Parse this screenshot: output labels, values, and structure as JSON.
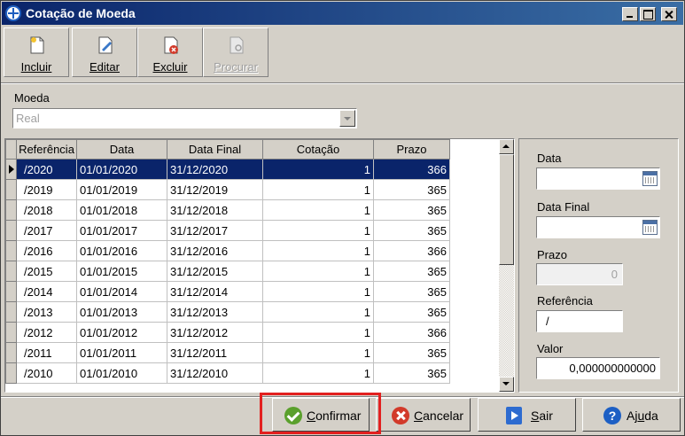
{
  "window": {
    "title": "Cotação de Moeda"
  },
  "toolbar": {
    "items": [
      {
        "label": "Incluir",
        "icon": "new-document-icon",
        "enabled": true
      },
      {
        "label": "Editar",
        "icon": "edit-document-icon",
        "enabled": true
      },
      {
        "label": "Excluir",
        "icon": "delete-document-icon",
        "enabled": true
      },
      {
        "label": "Procurar",
        "icon": "search-document-icon",
        "enabled": false
      }
    ]
  },
  "moeda": {
    "label": "Moeda",
    "value": "Real"
  },
  "grid": {
    "columns": [
      "Referência",
      "Data",
      "Data Final",
      "Cotação",
      "Prazo"
    ],
    "rows": [
      [
        "/2020",
        "01/01/2020",
        "31/12/2020",
        "1",
        "366"
      ],
      [
        "/2019",
        "01/01/2019",
        "31/12/2019",
        "1",
        "365"
      ],
      [
        "/2018",
        "01/01/2018",
        "31/12/2018",
        "1",
        "365"
      ],
      [
        "/2017",
        "01/01/2017",
        "31/12/2017",
        "1",
        "365"
      ],
      [
        "/2016",
        "01/01/2016",
        "31/12/2016",
        "1",
        "366"
      ],
      [
        "/2015",
        "01/01/2015",
        "31/12/2015",
        "1",
        "365"
      ],
      [
        "/2014",
        "01/01/2014",
        "31/12/2014",
        "1",
        "365"
      ],
      [
        "/2013",
        "01/01/2013",
        "31/12/2013",
        "1",
        "365"
      ],
      [
        "/2012",
        "01/01/2012",
        "31/12/2012",
        "1",
        "366"
      ],
      [
        "/2011",
        "01/01/2011",
        "31/12/2011",
        "1",
        "365"
      ],
      [
        "/2010",
        "01/01/2010",
        "31/12/2010",
        "1",
        "365"
      ]
    ],
    "selected_row": 0
  },
  "form": {
    "data_label": "Data",
    "data_value": "",
    "data_final_label": "Data Final",
    "data_final_value": "",
    "prazo_label": "Prazo",
    "prazo_value": "0",
    "referencia_label": "Referência",
    "referencia_value": "/",
    "valor_label": "Valor",
    "valor_value": "0,000000000000"
  },
  "buttons": {
    "confirm": "onfirmar",
    "confirm_key": "C",
    "cancel": "ancelar",
    "cancel_key": "C",
    "exit": "air",
    "exit_key": "S",
    "help": "Aj",
    "help_key": "u",
    "help_rest": "da"
  },
  "colors": {
    "selection": "#0a246a",
    "highlight": "#e2201f",
    "titlebar": "#0a246a"
  }
}
